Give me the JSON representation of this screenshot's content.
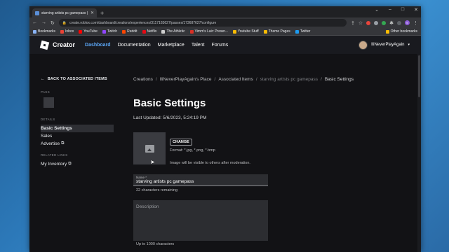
{
  "browser": {
    "tab_title": "starving artists pc gamepass | Ro...",
    "url": "create.roblox.com/dashboard/creations/experiences/3117183627/passes/173687627/configure",
    "window_controls": [
      "–",
      "□",
      "✕"
    ],
    "bookmarks": [
      {
        "label": "Bookmarks",
        "color": "#8ab4f8"
      },
      {
        "label": "Inbox",
        "color": "#ea4335"
      },
      {
        "label": "YouTube",
        "color": "#ff0000"
      },
      {
        "label": "Twitch",
        "color": "#9146ff"
      },
      {
        "label": "Reddit",
        "color": "#ff4500"
      },
      {
        "label": "Netflix",
        "color": "#e50914"
      },
      {
        "label": "The Athletic",
        "color": "#cfcfcf"
      },
      {
        "label": "Vimm's Lair: Preser...",
        "color": "#d93025"
      },
      {
        "label": "Youtube Stuff",
        "color": "#fbbc04"
      },
      {
        "label": "Theme Pages",
        "color": "#fbbc04"
      },
      {
        "label": "Twitter",
        "color": "#1d9bf0"
      }
    ],
    "other_bookmarks": "Other bookmarks"
  },
  "header": {
    "brand": "Creator",
    "nav": [
      "Dashboard",
      "Documentation",
      "Marketplace",
      "Talent",
      "Forums"
    ],
    "active_nav": "Dashboard",
    "username": "IliNeverPlayAgain"
  },
  "sidebar": {
    "back_label": "BACK TO ASSOCIATED ITEMS",
    "pass_section": "PASS",
    "details_section": "DETAILS",
    "details_items": [
      "Basic Settings",
      "Sales",
      "Advertise"
    ],
    "related_section": "RELATED LINKS",
    "related_items": [
      "My Inventory"
    ]
  },
  "breadcrumb": [
    "Creations",
    "IliNeverPlayAgain's Place",
    "Associated Items",
    "starving artists pc gamepass",
    "Basic Settings"
  ],
  "main": {
    "title": "Basic Settings",
    "last_updated": "Last Updated: 5/6/2023, 5:24:19 PM",
    "change_button": "CHANGE",
    "format_text": "Format: *.jpg, *.png, *.bmp",
    "visibility_text": "Image will be visible to others after moderation.",
    "name_label": "Name *",
    "name_value": "starving artists pc gamepass",
    "name_hint": "22 characters remaining",
    "description_placeholder": "Description",
    "description_hint": "Up to 1000 characters"
  },
  "colors": {
    "accent": "#5ba6f5",
    "background": "#121215"
  }
}
